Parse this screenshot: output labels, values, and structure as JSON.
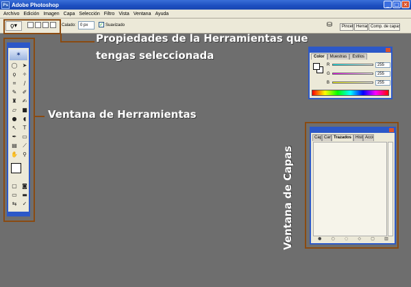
{
  "window": {
    "title": "Adobe Photoshop",
    "app_icon": "Ps",
    "buttons": [
      "_",
      "□",
      "×"
    ]
  },
  "menu": {
    "items": [
      "Archivo",
      "Edición",
      "Imagen",
      "Capa",
      "Selección",
      "Filtro",
      "Vista",
      "Ventana",
      "Ayuda"
    ]
  },
  "options": {
    "feather_label": "Calado:",
    "feather_value": "0 px",
    "antialias_label": "Suavizado",
    "antialias_checked": true,
    "well_tabs": [
      "Pinceles",
      "Herramientas",
      "Comp. de capas"
    ]
  },
  "annotations": {
    "options_line1": "Propiedades de la Herramientas que",
    "options_line2": "tengas seleccionada",
    "tools": "Ventana de Herramientas",
    "layers": "Ventana de Capas"
  },
  "color_palette": {
    "tabs": [
      "Color",
      "Muestras",
      "Estilos"
    ],
    "channels": [
      {
        "label": "R",
        "value": "255",
        "color": "#d94040"
      },
      {
        "label": "G",
        "value": "255",
        "color": "#3a9a3a"
      },
      {
        "label": "B",
        "value": "255",
        "color": "#3a5ad0"
      }
    ]
  },
  "layers_palette": {
    "tabs": [
      "Capas",
      "Canales",
      "Trazados",
      "Historia",
      "Acciones"
    ]
  },
  "colors": {
    "highlight": "#8a4a10",
    "palette_border": "#2c58c8",
    "background": "#6e6e6e"
  }
}
